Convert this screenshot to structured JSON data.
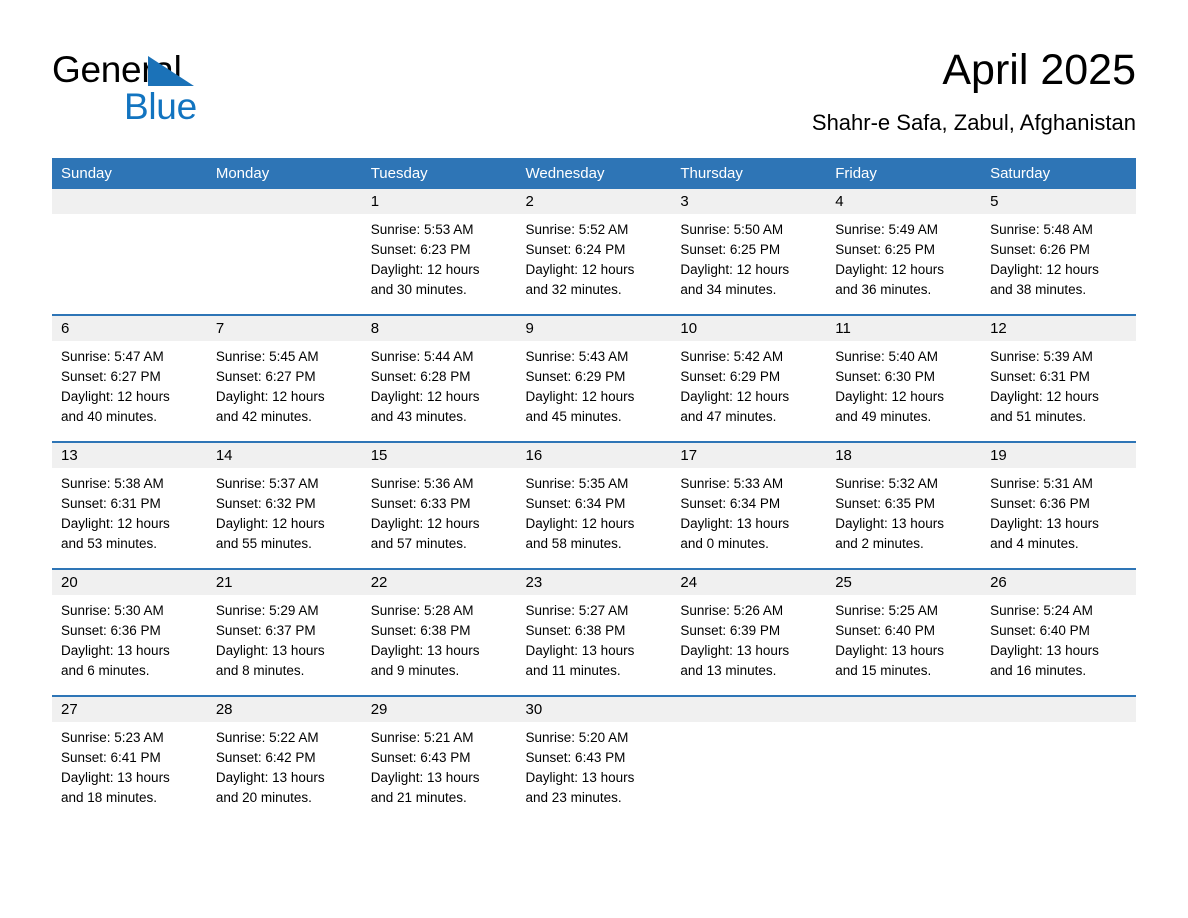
{
  "brand": {
    "name_part1": "General",
    "name_part2": "Blue",
    "accent_color": "#1274c0",
    "triangle_color": "#1b72b8"
  },
  "header": {
    "title": "April 2025",
    "subtitle": "Shahr-e Safa, Zabul, Afghanistan"
  },
  "calendar": {
    "header_bg": "#2e75b6",
    "daynum_bg": "#f0f0f0",
    "weekday_headers": [
      "Sunday",
      "Monday",
      "Tuesday",
      "Wednesday",
      "Thursday",
      "Friday",
      "Saturday"
    ],
    "weeks": [
      [
        {
          "day": "",
          "line1": "",
          "line2": "",
          "line3": "",
          "line4": ""
        },
        {
          "day": "",
          "line1": "",
          "line2": "",
          "line3": "",
          "line4": ""
        },
        {
          "day": "1",
          "line1": "Sunrise: 5:53 AM",
          "line2": "Sunset: 6:23 PM",
          "line3": "Daylight: 12 hours",
          "line4": "and 30 minutes."
        },
        {
          "day": "2",
          "line1": "Sunrise: 5:52 AM",
          "line2": "Sunset: 6:24 PM",
          "line3": "Daylight: 12 hours",
          "line4": "and 32 minutes."
        },
        {
          "day": "3",
          "line1": "Sunrise: 5:50 AM",
          "line2": "Sunset: 6:25 PM",
          "line3": "Daylight: 12 hours",
          "line4": "and 34 minutes."
        },
        {
          "day": "4",
          "line1": "Sunrise: 5:49 AM",
          "line2": "Sunset: 6:25 PM",
          "line3": "Daylight: 12 hours",
          "line4": "and 36 minutes."
        },
        {
          "day": "5",
          "line1": "Sunrise: 5:48 AM",
          "line2": "Sunset: 6:26 PM",
          "line3": "Daylight: 12 hours",
          "line4": "and 38 minutes."
        }
      ],
      [
        {
          "day": "6",
          "line1": "Sunrise: 5:47 AM",
          "line2": "Sunset: 6:27 PM",
          "line3": "Daylight: 12 hours",
          "line4": "and 40 minutes."
        },
        {
          "day": "7",
          "line1": "Sunrise: 5:45 AM",
          "line2": "Sunset: 6:27 PM",
          "line3": "Daylight: 12 hours",
          "line4": "and 42 minutes."
        },
        {
          "day": "8",
          "line1": "Sunrise: 5:44 AM",
          "line2": "Sunset: 6:28 PM",
          "line3": "Daylight: 12 hours",
          "line4": "and 43 minutes."
        },
        {
          "day": "9",
          "line1": "Sunrise: 5:43 AM",
          "line2": "Sunset: 6:29 PM",
          "line3": "Daylight: 12 hours",
          "line4": "and 45 minutes."
        },
        {
          "day": "10",
          "line1": "Sunrise: 5:42 AM",
          "line2": "Sunset: 6:29 PM",
          "line3": "Daylight: 12 hours",
          "line4": "and 47 minutes."
        },
        {
          "day": "11",
          "line1": "Sunrise: 5:40 AM",
          "line2": "Sunset: 6:30 PM",
          "line3": "Daylight: 12 hours",
          "line4": "and 49 minutes."
        },
        {
          "day": "12",
          "line1": "Sunrise: 5:39 AM",
          "line2": "Sunset: 6:31 PM",
          "line3": "Daylight: 12 hours",
          "line4": "and 51 minutes."
        }
      ],
      [
        {
          "day": "13",
          "line1": "Sunrise: 5:38 AM",
          "line2": "Sunset: 6:31 PM",
          "line3": "Daylight: 12 hours",
          "line4": "and 53 minutes."
        },
        {
          "day": "14",
          "line1": "Sunrise: 5:37 AM",
          "line2": "Sunset: 6:32 PM",
          "line3": "Daylight: 12 hours",
          "line4": "and 55 minutes."
        },
        {
          "day": "15",
          "line1": "Sunrise: 5:36 AM",
          "line2": "Sunset: 6:33 PM",
          "line3": "Daylight: 12 hours",
          "line4": "and 57 minutes."
        },
        {
          "day": "16",
          "line1": "Sunrise: 5:35 AM",
          "line2": "Sunset: 6:34 PM",
          "line3": "Daylight: 12 hours",
          "line4": "and 58 minutes."
        },
        {
          "day": "17",
          "line1": "Sunrise: 5:33 AM",
          "line2": "Sunset: 6:34 PM",
          "line3": "Daylight: 13 hours",
          "line4": "and 0 minutes."
        },
        {
          "day": "18",
          "line1": "Sunrise: 5:32 AM",
          "line2": "Sunset: 6:35 PM",
          "line3": "Daylight: 13 hours",
          "line4": "and 2 minutes."
        },
        {
          "day": "19",
          "line1": "Sunrise: 5:31 AM",
          "line2": "Sunset: 6:36 PM",
          "line3": "Daylight: 13 hours",
          "line4": "and 4 minutes."
        }
      ],
      [
        {
          "day": "20",
          "line1": "Sunrise: 5:30 AM",
          "line2": "Sunset: 6:36 PM",
          "line3": "Daylight: 13 hours",
          "line4": "and 6 minutes."
        },
        {
          "day": "21",
          "line1": "Sunrise: 5:29 AM",
          "line2": "Sunset: 6:37 PM",
          "line3": "Daylight: 13 hours",
          "line4": "and 8 minutes."
        },
        {
          "day": "22",
          "line1": "Sunrise: 5:28 AM",
          "line2": "Sunset: 6:38 PM",
          "line3": "Daylight: 13 hours",
          "line4": "and 9 minutes."
        },
        {
          "day": "23",
          "line1": "Sunrise: 5:27 AM",
          "line2": "Sunset: 6:38 PM",
          "line3": "Daylight: 13 hours",
          "line4": "and 11 minutes."
        },
        {
          "day": "24",
          "line1": "Sunrise: 5:26 AM",
          "line2": "Sunset: 6:39 PM",
          "line3": "Daylight: 13 hours",
          "line4": "and 13 minutes."
        },
        {
          "day": "25",
          "line1": "Sunrise: 5:25 AM",
          "line2": "Sunset: 6:40 PM",
          "line3": "Daylight: 13 hours",
          "line4": "and 15 minutes."
        },
        {
          "day": "26",
          "line1": "Sunrise: 5:24 AM",
          "line2": "Sunset: 6:40 PM",
          "line3": "Daylight: 13 hours",
          "line4": "and 16 minutes."
        }
      ],
      [
        {
          "day": "27",
          "line1": "Sunrise: 5:23 AM",
          "line2": "Sunset: 6:41 PM",
          "line3": "Daylight: 13 hours",
          "line4": "and 18 minutes."
        },
        {
          "day": "28",
          "line1": "Sunrise: 5:22 AM",
          "line2": "Sunset: 6:42 PM",
          "line3": "Daylight: 13 hours",
          "line4": "and 20 minutes."
        },
        {
          "day": "29",
          "line1": "Sunrise: 5:21 AM",
          "line2": "Sunset: 6:43 PM",
          "line3": "Daylight: 13 hours",
          "line4": "and 21 minutes."
        },
        {
          "day": "30",
          "line1": "Sunrise: 5:20 AM",
          "line2": "Sunset: 6:43 PM",
          "line3": "Daylight: 13 hours",
          "line4": "and 23 minutes."
        },
        {
          "day": "",
          "line1": "",
          "line2": "",
          "line3": "",
          "line4": ""
        },
        {
          "day": "",
          "line1": "",
          "line2": "",
          "line3": "",
          "line4": ""
        },
        {
          "day": "",
          "line1": "",
          "line2": "",
          "line3": "",
          "line4": ""
        }
      ]
    ]
  }
}
